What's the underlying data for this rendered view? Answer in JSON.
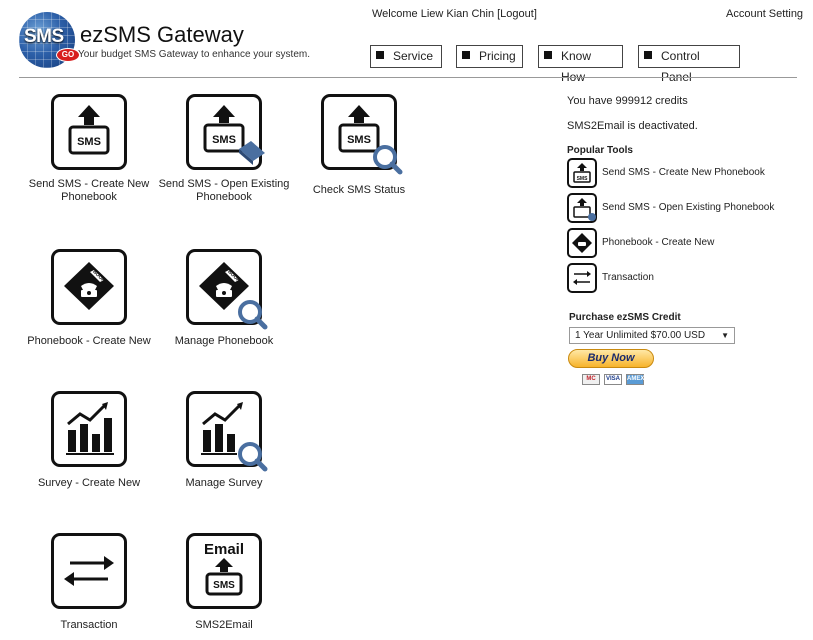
{
  "header": {
    "logo_text": "SMS",
    "logo_badge": "GO",
    "app_title": "ezSMS Gateway",
    "tagline": "Your budget SMS Gateway to enhance your system.",
    "welcome": "Welcome Liew Kian Chin [Logout]",
    "account_setting": "Account Setting"
  },
  "nav": [
    {
      "label": "Service"
    },
    {
      "label": "Pricing"
    },
    {
      "label": "Know How"
    },
    {
      "label": "Control Panel"
    }
  ],
  "tiles": [
    {
      "label": "Send SMS - Create New Phonebook",
      "icon": "sms-upload-icon"
    },
    {
      "label": "Send SMS - Open Existing Phonebook",
      "icon": "sms-phonebook-icon"
    },
    {
      "label": "Check SMS Status",
      "icon": "sms-check-status-icon"
    },
    {
      "label": "Phonebook - Create New",
      "icon": "phonebook-icon"
    },
    {
      "label": "Manage Phonebook",
      "icon": "manage-phonebook-icon"
    },
    {
      "label": "Survey - Create New",
      "icon": "survey-chart-icon"
    },
    {
      "label": "Manage Survey",
      "icon": "manage-survey-icon"
    },
    {
      "label": "Transaction",
      "icon": "transaction-arrows-icon"
    },
    {
      "label": "SMS2Email",
      "icon": "sms2email-icon",
      "icon_text": "Email"
    }
  ],
  "sidebar": {
    "credits": "You have 999912 credits",
    "sms2email_status": "SMS2Email is deactivated.",
    "popular_title": "Popular Tools",
    "popular": [
      {
        "label": "Send SMS - Create New Phonebook"
      },
      {
        "label": "Send SMS - Open Existing Phonebook"
      },
      {
        "label": "Phonebook - Create New"
      },
      {
        "label": "Transaction"
      }
    ],
    "purchase_title": "Purchase ezSMS Credit",
    "plan_selected": "1 Year Unlimited $70.00 USD",
    "buy_label": "Buy Now",
    "cards": [
      "MC",
      "VISA",
      "AMEX"
    ]
  },
  "icon_text": {
    "sms": "SMS",
    "book": "BOOK"
  },
  "colors": {
    "accent_blue": "#2c5fa8",
    "buy_button": "#f7b32b",
    "icon_stroke": "#111111"
  }
}
